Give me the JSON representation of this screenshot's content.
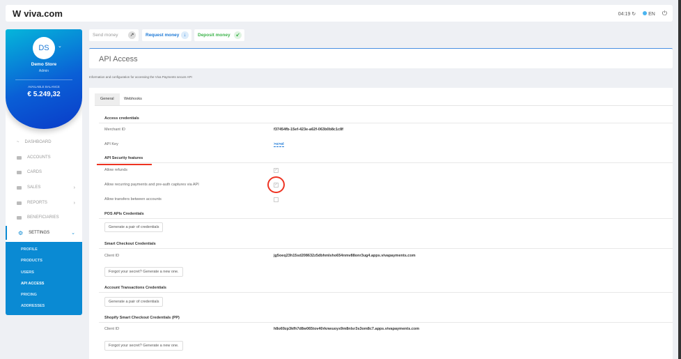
{
  "header": {
    "logo": "viva.com",
    "time": "04:19",
    "language": "EN"
  },
  "sidebar": {
    "initials": "DS",
    "store": "Demo Store",
    "role": "Admin",
    "balance_label": "AVAILABLE BALANCE",
    "balance": "€ 5.249,32",
    "items": [
      {
        "label": "DASHBOARD"
      },
      {
        "label": "ACCOUNTS"
      },
      {
        "label": "CARDS"
      },
      {
        "label": "SALES"
      },
      {
        "label": "REPORTS"
      },
      {
        "label": "BENEFICIARIES"
      },
      {
        "label": "SETTINGS"
      }
    ],
    "sub_items": [
      {
        "label": "PROFILE"
      },
      {
        "label": "PRODUCTS"
      },
      {
        "label": "USERS"
      },
      {
        "label": "API ACCESS"
      },
      {
        "label": "PRICING"
      },
      {
        "label": "ADDRESSES"
      }
    ]
  },
  "actions": {
    "send": "Send money",
    "request": "Request money",
    "deposit": "Deposit money"
  },
  "page": {
    "title": "API Access",
    "description": "Information and configuration for accessing the Viva Payments secure API",
    "tabs": [
      "General",
      "Webhooks"
    ],
    "access": {
      "heading": "Access credentials",
      "merchant_label": "Merchant ID",
      "merchant_id": "f37454fb-15ef-423e-a62f-063b0b8c1c8f",
      "api_key_label": "API Key",
      "api_key": ">o>ol"
    },
    "security": {
      "heading": "API Security features",
      "refunds": "Allow refunds",
      "refunds_checked": true,
      "recurring": "Allow recurring payments and pre-auth captures via API",
      "recurring_checked": true,
      "transfers": "Allow transfers between accounts",
      "transfers_checked": false
    },
    "pos": {
      "heading": "POS APIs Credentials",
      "button": "Generate a pair of credentials"
    },
    "smart": {
      "heading": "Smart Checkout Credentials",
      "client_label": "Client ID",
      "client_id": "jg5oeq23h15sd208632z5dbhmlsho654nmv88onr3ug4.apps.vivapayments.com",
      "button": "Forgot your secret? Generate a new one."
    },
    "account": {
      "heading": "Account Transactions Credentials",
      "button": "Generate a pair of credentials"
    },
    "shopify": {
      "heading": "Shopify Smart Checkout Credentials (PP)",
      "client_label": "Client ID",
      "client_id": "h8o69zp3kfh7d8w065tov40rknwuoyx9m8nlsr3s3om8c7.apps.vivapayments.com",
      "button": "Forgot your secret? Generate a new one."
    }
  }
}
